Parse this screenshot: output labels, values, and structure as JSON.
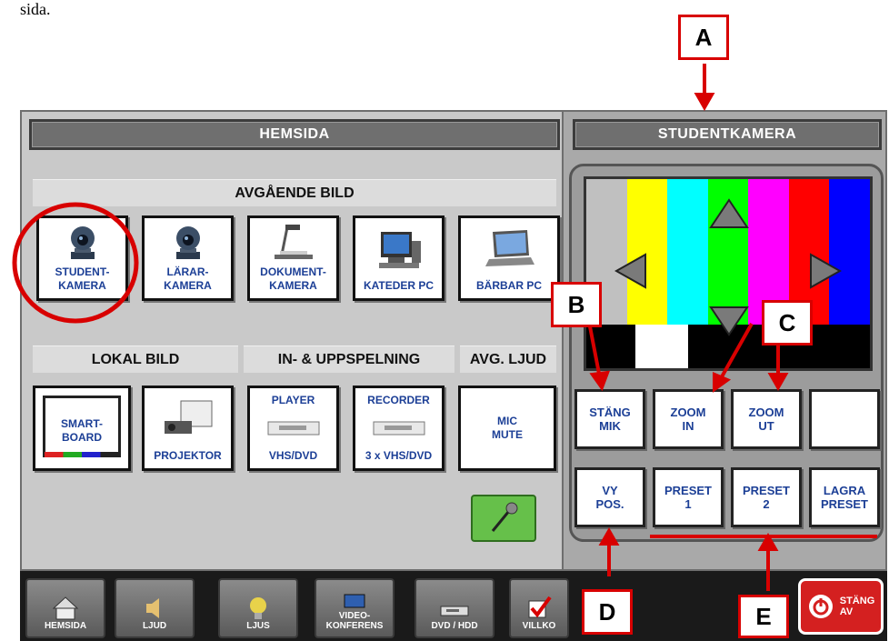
{
  "top_text": "sida.",
  "home_panel": {
    "title": "HEMSIDA",
    "outgoing_section": "AVGÅENDE BILD",
    "outgoing_tiles": [
      "STUDENT-\nKAMERA",
      "LÄRAR-\nKAMERA",
      "DOKUMENT-\nKAMERA",
      "KATEDER PC",
      "BÄRBAR PC"
    ],
    "local_section": "LOKAL BILD",
    "playback_section": "IN- & UPPSPELNING",
    "audio_section": "AVG. LJUD",
    "local_tiles": [
      "SMART-\nBOARD",
      "PROJEKTOR"
    ],
    "player_tile": {
      "top": "PLAYER",
      "bottom": "VHS/DVD"
    },
    "recorder_tile": {
      "top": "RECORDER",
      "bottom": "3 x VHS/DVD"
    },
    "mic_mute": "MIC\nMUTE"
  },
  "camera_panel": {
    "title": "STUDENTKAMERA",
    "buttons_row1": [
      "STÄNG\nMIK",
      "ZOOM\nIN",
      "ZOOM\nUT",
      ""
    ],
    "buttons_row2": [
      "VY\nPOS.",
      "PRESET\n1",
      "PRESET\n2",
      "LAGRA\nPRESET"
    ]
  },
  "nav": {
    "items": [
      "HEMSIDA",
      "LJUD",
      "LJUS",
      "VIDEO-\nKONFERENS",
      "DVD / HDD",
      "VILLKO"
    ],
    "power_label": "STÄNG\nAV"
  },
  "callouts": [
    "A",
    "B",
    "C",
    "D",
    "E"
  ],
  "colors": {
    "accent_red": "#d80000",
    "label_blue": "#1c3f96",
    "panel_gray": "#c9c9c9"
  }
}
